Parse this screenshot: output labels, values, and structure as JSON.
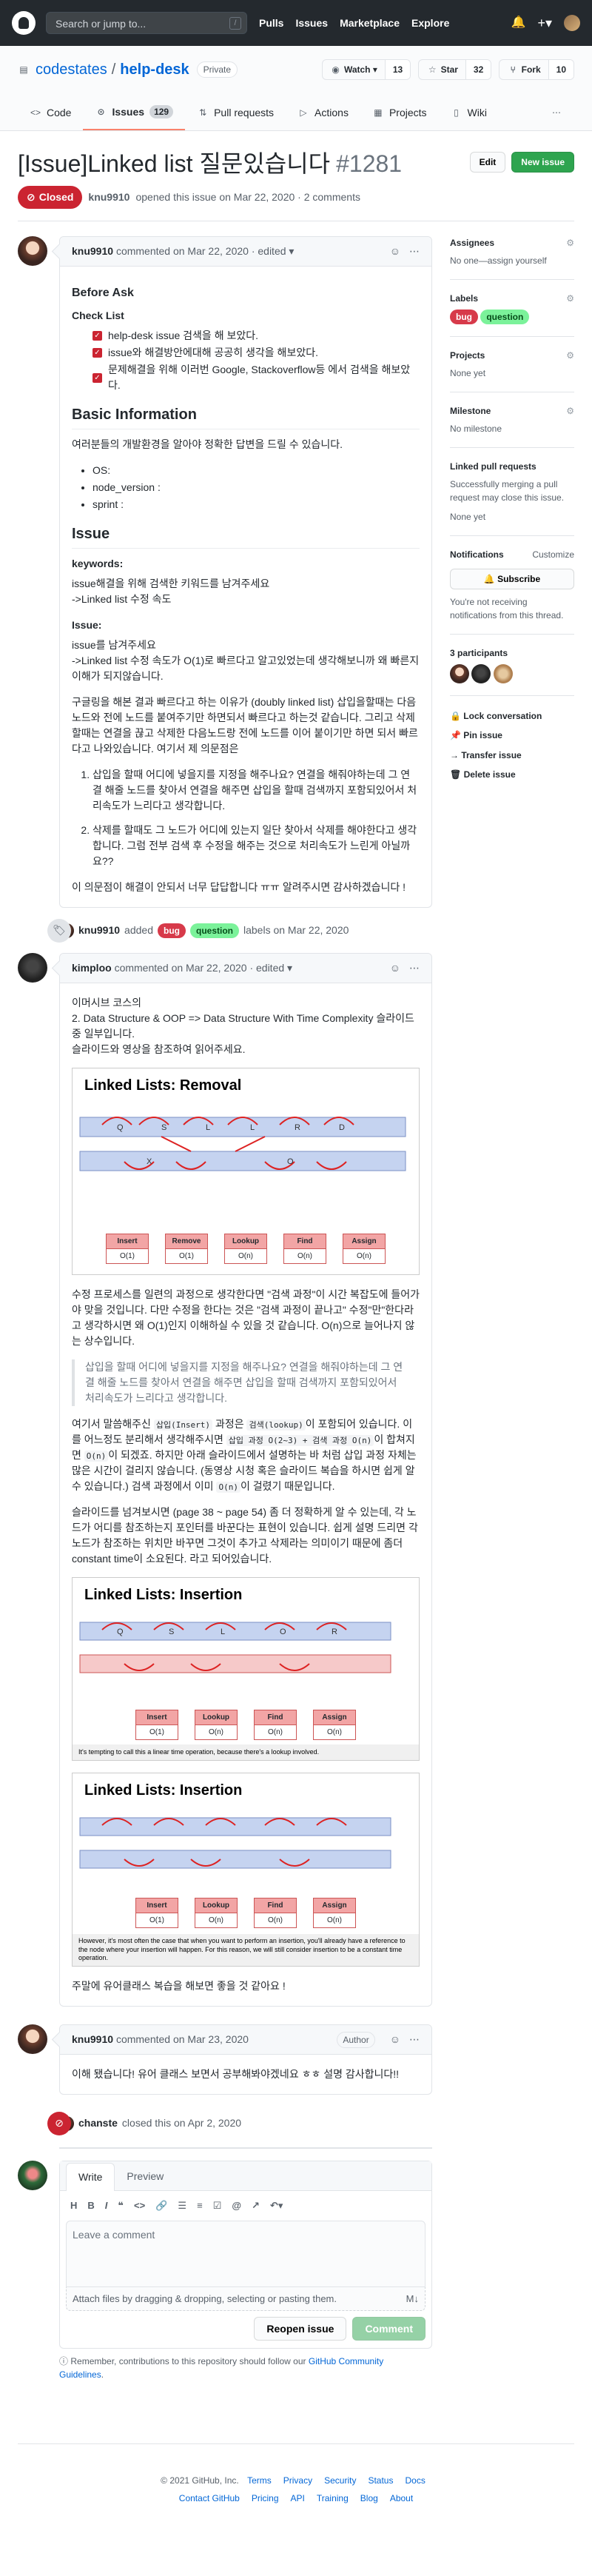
{
  "header": {
    "search_placeholder": "Search or jump to...",
    "slash_key": "/",
    "nav": [
      "Pulls",
      "Issues",
      "Marketplace",
      "Explore"
    ]
  },
  "repo": {
    "owner": "codestates",
    "name": "help-desk",
    "visibility": "Private",
    "watch": {
      "label": "Watch",
      "count": "13"
    },
    "star": {
      "label": "Star",
      "count": "32"
    },
    "fork": {
      "label": "Fork",
      "count": "10"
    },
    "tabs": [
      {
        "label": "Code",
        "icon": "code-icon"
      },
      {
        "label": "Issues",
        "icon": "issue-icon",
        "count": "129",
        "selected": true
      },
      {
        "label": "Pull requests",
        "icon": "pull-request-icon"
      },
      {
        "label": "Actions",
        "icon": "play-icon"
      },
      {
        "label": "Projects",
        "icon": "project-icon"
      },
      {
        "label": "Wiki",
        "icon": "book-icon"
      }
    ]
  },
  "issue": {
    "title": "[Issue]Linked list 질문있습니다",
    "number": "#1281",
    "edit": "Edit",
    "new_issue": "New issue",
    "state": "Closed",
    "author": "knu9910",
    "opened_text": "opened this issue on Mar 22, 2020 · 2 comments"
  },
  "comment1": {
    "author": "knu9910",
    "meta": "commented on Mar 22, 2020 · edited",
    "before_ask": "Before Ask",
    "check_list": "Check List",
    "checks": [
      "help-desk issue 검색을 해 보았다.",
      "issue와 해결방안에대해 공공히 생각을 해보았다.",
      "문제해결을 위해 이러번 Google, Stackoverflow등 에서 검색을 해보았다."
    ],
    "basic_info": "Basic Information",
    "basic_desc": "여러분들의 개발환경을 알아야 정확한 답변을 드릴 수 있습니다.",
    "env": [
      "OS:",
      "node_version :",
      "sprint :"
    ],
    "issue_h": "Issue",
    "keywords_h": "keywords:",
    "keywords_p1": "issue해결을 위해 검색한 키워드를 남겨주세요",
    "keywords_p2": "->Linked list 수정 속도",
    "issue2_h": "Issue:",
    "issue_p1": "issue를 남겨주세요",
    "issue_p2": "->Linked list 수정 속도가 O(1)로 빠르다고 알고있었는데 생각해보니까 왜 빠른지 이해가 되지않습니다.",
    "issue_p3": "구글링을 해본 결과 빠르다고 하는 이유가 (doubly linked list) 삽입을할때는 다음노드와 전에 노드를 붙여주기만 하면되서 빠르다고 하는것 같습니다. 그리고 삭제 할때는 연결을 끊고 삭제한 다음노드랑 전에 노드를 이어 붙이기만 하면 되서 빠르다고 나와있습니다. 여기서 제 의문점은",
    "questions": [
      "삽입을 할때 어디에 넣을지를 지정을 해주나요? 연결을 해줘야하는데 그 연결 해줄 노드를 찾아서 연결을 해주면 삽입을 할때 검색까지 포함되있어서 처리속도가 느리다고 생각합니다.",
      "삭제를 할때도 그 노드가 어디에 있는지 일단 찾아서 삭제를 해야한다고 생각합니다. 그럼 전부 검색 후 수정을 해주는 것으로 처리속도가 느린게 아닐까요??"
    ],
    "closing": "이 의문점이 해결이 안되서 너무 답답합니다 ㅠㅠ 알려주시면 감사하겠습니다 !"
  },
  "label_event": {
    "actor": "knu9910",
    "text1": "added",
    "text2": "labels on Mar 22, 2020",
    "labels": [
      "bug",
      "question"
    ]
  },
  "comment2": {
    "author": "kimploo",
    "meta": "commented on Mar 22, 2020 · edited",
    "p1": "이머시브 코스의",
    "p2": "2. Data Structure & OOP => Data Structure With Time Complexity 슬라이드 중 일부입니다.",
    "p3": "슬라이드와 영상을 참조하여 읽어주세요.",
    "slide1_title": "Linked Lists: Removal",
    "ops": [
      {
        "t": "Insert",
        "v": "O(1)"
      },
      {
        "t": "Remove",
        "v": "O(1)"
      },
      {
        "t": "Lookup",
        "v": "O(n)"
      },
      {
        "t": "Find",
        "v": "O(n)"
      },
      {
        "t": "Assign",
        "v": "O(n)"
      }
    ],
    "p4": "수정 프로세스를 일련의 과정으로 생각한다면 \"검색 과정\"이 시간 복잡도에 들어가야 맞을 것입니다. 다만 수정을 한다는 것은 \"검색 과정이 끝나고\" 수정\"만\"한다라고 생각하시면 왜 O(1)인지 이해하실 수 있을 것 같습니다. O(n)으로 늘어나지 않는 상수입니다.",
    "quote": "삽입을 할때 어디에 넣을지를 지정을 해주나요? 연결을 해줘야하는데 그 연결 해줄 노드를 찾아서 연결을 해주면 삽입을 할때 검색까지 포함되있어서 처리속도가 느리다고 생각합니다.",
    "p5a": "여기서 말씀해주신 ",
    "p5b": "삽입(Insert)",
    "p5c": " 과정은 ",
    "p5d": "검색(lookup)",
    "p5e": "이 포함되어 있습니다. 이를 어느정도 분리해서 생각해주시면 ",
    "p5f": "삽입 과정 O(2~3) + 검색 과정 O(n)",
    "p5g": "이 합쳐지면 ",
    "p5h": "O(n)",
    "p5i": "이 되겠죠. 하지만 아래 슬라이드에서 설명하는 바 처럼 삽입 과정 자체는 많은 시간이 걸리지 않습니다. (동영상 시청 혹은 슬라이드 복습을 하시면 쉽게 알 수 있습니다.) 검색 과정에서 이미 ",
    "p5j": "O(n)",
    "p5k": "이 걸렸기 때문입니다.",
    "p6": "슬라이드를 넘겨보시면 (page 38 ~ page 54) 좀 더 정확하게 알 수 있는데, 각 노드가 어디를 참조하는지 포인터를 바꾼다는 표현이 있습니다. 쉽게 설명 드리면 각 노드가 참조하는 위치만 바꾸면 그것이 추가고 삭제라는 의미이기 때문에 좀더 constant time이 소요된다. 라고 되어있습니다.",
    "slide2_title": "Linked Lists: Insertion",
    "slide2_note": "It's tempting to call this a linear time operation, because there's a lookup involved.",
    "slide3_title": "Linked Lists: Insertion",
    "slide3_note": "However, it's most often the case that when you want to perform an insertion, you'll already have a reference to the node where your insertion will happen. For this reason, we will still consider insertion to be a constant time operation.",
    "p7": "주말에 유어클래스 복습을 해보면 좋을 것 같아요 !"
  },
  "comment3": {
    "author": "knu9910",
    "meta": "commented on Mar 23, 2020",
    "badge": "Author",
    "body": "이해 됐습니다! 유어 클래스 보면서 공부해봐야겠네요 ㅎㅎ 설명 감사합니다!!"
  },
  "close_event": {
    "actor": "chanste",
    "text": "closed this on Apr 2, 2020"
  },
  "editor": {
    "write": "Write",
    "preview": "Preview",
    "placeholder": "Leave a comment",
    "attach": "Attach files by dragging & dropping, selecting or pasting them.",
    "reopen": "Reopen issue",
    "comment": "Comment"
  },
  "notice": {
    "text": "Remember, contributions to this repository should follow our",
    "link": "GitHub Community Guidelines",
    "end": "."
  },
  "sidebar": {
    "assignees": "Assignees",
    "assignees_v": "No one—assign yourself",
    "labels": "Labels",
    "projects": "Projects",
    "projects_v": "None yet",
    "milestone": "Milestone",
    "milestone_v": "No milestone",
    "linked": "Linked pull requests",
    "linked_desc": "Successfully merging a pull request may close this issue.",
    "linked_v": "None yet",
    "notif": "Notifications",
    "customize": "Customize",
    "subscribe": "Subscribe",
    "notif_desc": "You're not receiving notifications from this thread.",
    "participants": "3 participants",
    "lock": "Lock conversation",
    "pin": "Pin issue",
    "transfer": "Transfer issue",
    "delete": "Delete issue"
  },
  "footer": {
    "copy": "© 2021 GitHub, Inc.",
    "links1": [
      "Terms",
      "Privacy",
      "Security",
      "Status",
      "Docs"
    ],
    "links2": [
      "Contact GitHub",
      "Pricing",
      "API",
      "Training",
      "Blog",
      "About"
    ]
  },
  "colors": {
    "closed": "#cb2431",
    "green": "#2ea44f",
    "bug": "#d73a4a",
    "question": "#7bf29a"
  }
}
